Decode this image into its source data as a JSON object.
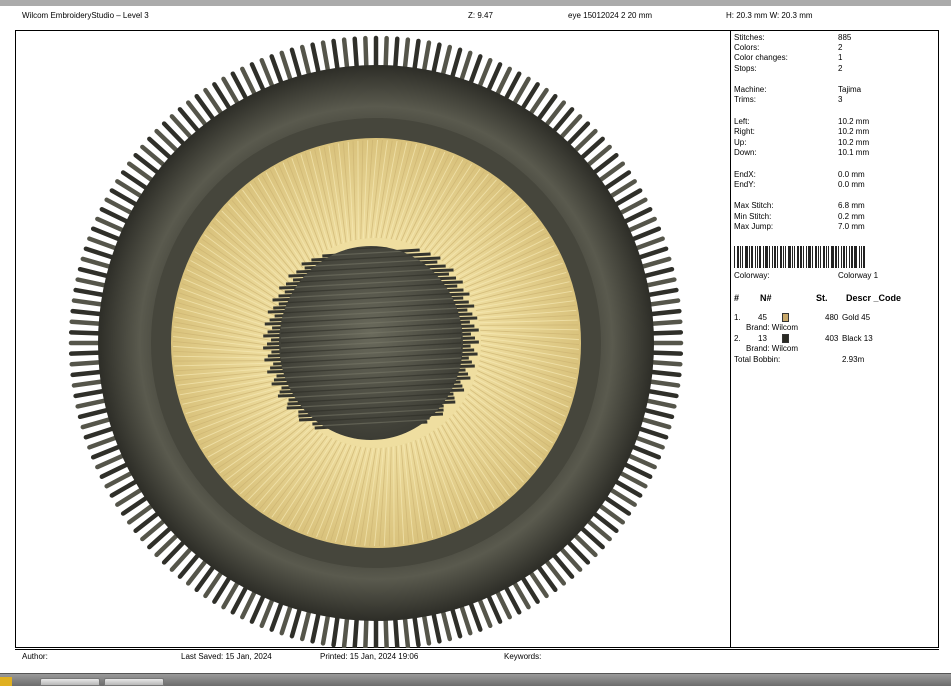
{
  "header": {
    "title": "Wilcom EmbroideryStudio – Level 3",
    "zoom": "Z: 9.47",
    "design_name": "eye 15012024 2 20 mm",
    "size": "H: 20.3 mm   W: 20.3 mm"
  },
  "stats": [
    {
      "label": "Stitches:",
      "value": "885"
    },
    {
      "label": "Colors:",
      "value": "2"
    },
    {
      "label": "Color changes:",
      "value": "1"
    },
    {
      "label": "Stops:",
      "value": "2"
    },
    {
      "label": "Machine:",
      "value": "Tajima"
    },
    {
      "label": "Trims:",
      "value": "3"
    },
    {
      "label": "Left:",
      "value": "10.2 mm"
    },
    {
      "label": "Right:",
      "value": "10.2 mm"
    },
    {
      "label": "Up:",
      "value": "10.2 mm"
    },
    {
      "label": "Down:",
      "value": "10.1 mm"
    },
    {
      "label": "EndX:",
      "value": "0.0 mm"
    },
    {
      "label": "EndY:",
      "value": "0.0 mm"
    },
    {
      "label": "Max Stitch:",
      "value": "6.8 mm"
    },
    {
      "label": "Min Stitch:",
      "value": "0.2 mm"
    },
    {
      "label": "Max Jump:",
      "value": "7.0 mm"
    }
  ],
  "colorway": {
    "label": "Colorway:",
    "value": "Colorway 1"
  },
  "color_table": {
    "headers": {
      "num": "#",
      "code": "N#",
      "stitches": "St.",
      "descr": "Descr _Code"
    },
    "rows": [
      {
        "index": "1.",
        "code": "45",
        "color": "#c8a86a",
        "stitches": "480",
        "descr": "Gold 45",
        "brand": "Brand: Wilcom"
      },
      {
        "index": "2.",
        "code": "13",
        "color": "#2a2a24",
        "stitches": "403",
        "descr": "Black 13",
        "brand": "Brand: Wilcom"
      }
    ],
    "total_bobbin_label": "Total Bobbin:",
    "total_bobbin_value": "2.93m"
  },
  "footer": {
    "author": "Author:",
    "last_saved": "Last Saved: 15 Jan, 2024",
    "printed": "Printed: 15 Jan, 2024 19:06",
    "keywords": "Keywords:"
  },
  "colors": {
    "gold_thread": "#e3cf8c",
    "black_thread": "#4a4a40"
  }
}
